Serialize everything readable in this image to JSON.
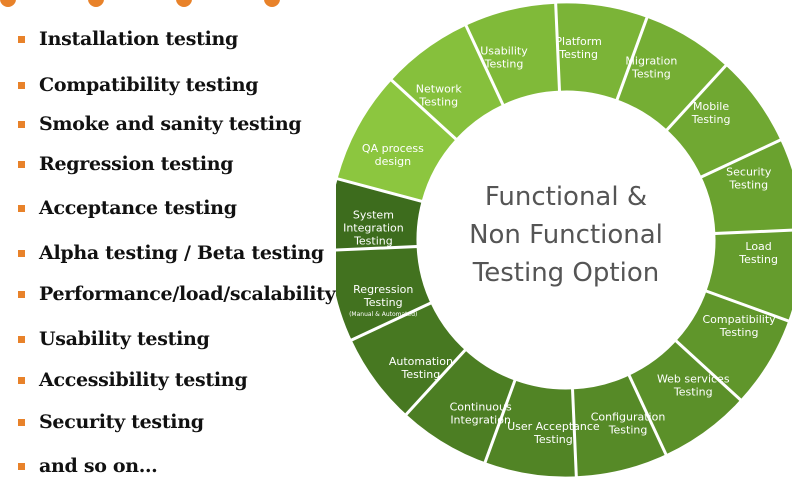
{
  "bullets": [
    "Installation testing",
    "Compatibility testing",
    "Smoke and sanity testing",
    "Regression testing",
    "Acceptance testing",
    "Alpha testing / Beta testing",
    "Performance/load/scalability testing",
    "Usability testing",
    "Accessibility testing",
    "Security testing",
    "and so on…"
  ],
  "wheel": {
    "center_title_lines": [
      "Functional &",
      "Non Functional",
      "Testing Option"
    ],
    "segments": [
      {
        "lines": [
          "QA process",
          "design"
        ],
        "sub": "",
        "color": "#8cc63f"
      },
      {
        "lines": [
          "Network",
          "Testing"
        ],
        "sub": "",
        "color": "#86c03c"
      },
      {
        "lines": [
          "Usability",
          "Testing"
        ],
        "sub": "",
        "color": "#80ba39"
      },
      {
        "lines": [
          "Platform",
          "Testing"
        ],
        "sub": "",
        "color": "#7bb437"
      },
      {
        "lines": [
          "Migration",
          "Testing"
        ],
        "sub": "",
        "color": "#75ae34"
      },
      {
        "lines": [
          "Mobile",
          "Testing"
        ],
        "sub": "",
        "color": "#70a832"
      },
      {
        "lines": [
          "Security",
          "Testing"
        ],
        "sub": "",
        "color": "#6aa22f"
      },
      {
        "lines": [
          "Load",
          "Testing"
        ],
        "sub": "",
        "color": "#659c2d"
      },
      {
        "lines": [
          "Compatibility",
          "Testing"
        ],
        "sub": "",
        "color": "#60962b"
      },
      {
        "lines": [
          "Web services",
          "Testing"
        ],
        "sub": "",
        "color": "#5b9029"
      },
      {
        "lines": [
          "Configuration",
          "Testing"
        ],
        "sub": "",
        "color": "#568a27"
      },
      {
        "lines": [
          "User Acceptance",
          "Testing"
        ],
        "sub": "",
        "color": "#518425"
      },
      {
        "lines": [
          "Continuous",
          "Integration"
        ],
        "sub": "",
        "color": "#4c7e23"
      },
      {
        "lines": [
          "Automation",
          "Testing"
        ],
        "sub": "",
        "color": "#477821"
      },
      {
        "lines": [
          "Regression",
          "Testing"
        ],
        "sub": "(Manual & Automated)",
        "color": "#42721f"
      },
      {
        "lines": [
          "System",
          "Integration",
          "Testing"
        ],
        "sub": "",
        "color": "#3d6c1d"
      }
    ]
  },
  "colors": {
    "bullet": "#e8822a",
    "text": "#111111",
    "center_text": "#555555",
    "wheel_text": "#ffffff"
  }
}
